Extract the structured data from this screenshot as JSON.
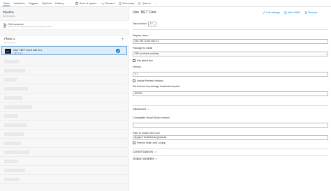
{
  "tabs": [
    "Tasks",
    "Variables",
    "Triggers",
    "Options",
    "History"
  ],
  "toolbar": {
    "save_label": "Save & queue",
    "discard_label": "Discard",
    "summary_label": "Summary",
    "queue_label": "Queue",
    "more_label": "..."
  },
  "left": {
    "pipeline_title": "Pipeline",
    "pipeline_subtitle": "Build pipeline",
    "get_sources_title": "Get sources",
    "get_sources_subtitle": "devenvironmenttogo/azure-ae-demo-ping-data     master",
    "phase_title": "Phase 1",
    "phase_subtitle": "Run on agent",
    "task_title": "Use .NET Core sdk 3.1",
    "task_subtitle": ".NET Core",
    "task_icon_text": ".NET",
    "blurred_rows": 12
  },
  "right": {
    "title": "Use .NET Core",
    "link_settings": "Link settings",
    "view_yaml": "View YAML",
    "remove": "Remove",
    "task_version_label": "Task version",
    "task_version_value": "2.*",
    "display_name_label": "Display name *",
    "display_name_value": "Use .NET Core sdk 3.1",
    "package_label": "Package to install",
    "package_value": "SDK (contains runtime)",
    "use_global_json": "Use global json",
    "version_label": "Version",
    "version_value": "3.1",
    "include_preview": "Include Preview Versions",
    "timeout_label": "Set timeout for package download request",
    "timeout_value": "300000",
    "advanced_label": "Advanced",
    "compatible_vs_label": "Compatible Visual Studio version",
    "compatible_vs_value": "",
    "path_label": "Path To Install .Net Core",
    "path_value": "$(Agent.ToolsDirectory)/dotnet",
    "perform_multi_level": "Perform Multi Level Lookup",
    "control_options": "Control Options",
    "output_variables": "Output Variables"
  },
  "colors": {
    "accent": "#0078d4",
    "selected_bg": "#dcecf9",
    "pane_bg": "#f7f7f7"
  }
}
